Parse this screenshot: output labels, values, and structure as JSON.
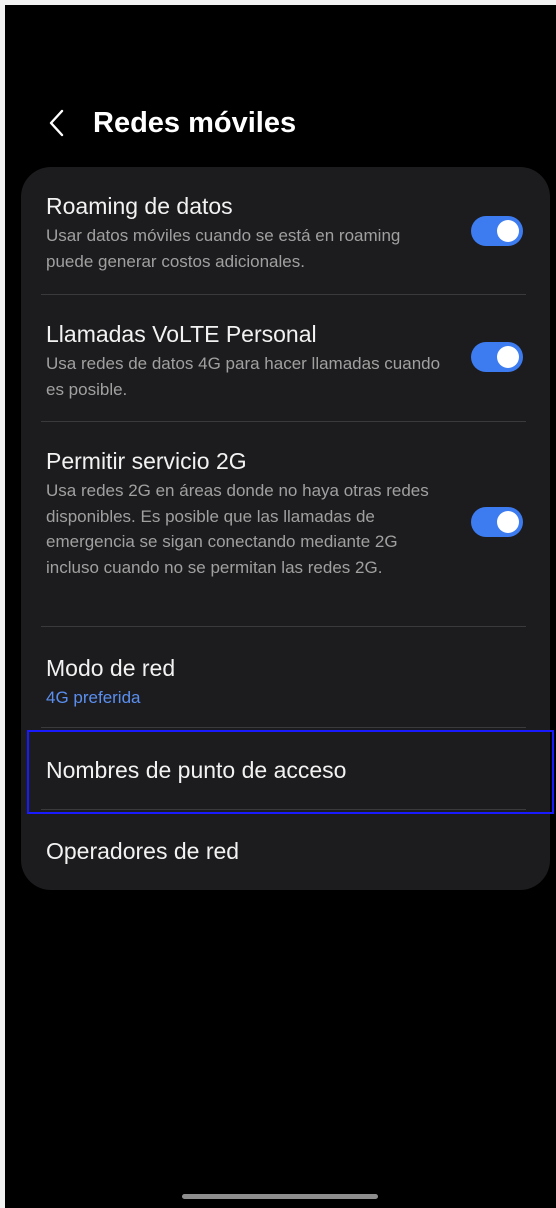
{
  "header": {
    "title": "Redes móviles",
    "back_icon": "chevron-left-icon"
  },
  "settings": {
    "roaming": {
      "title": "Roaming de datos",
      "description": "Usar datos móviles cuando se está en roaming puede generar costos adicionales.",
      "enabled": true
    },
    "volte": {
      "title": "Llamadas VoLTE Personal",
      "description": "Usa redes de datos 4G para hacer llamadas cuando es posible.",
      "enabled": true
    },
    "allow_2g": {
      "title": "Permitir servicio 2G",
      "description": "Usa redes 2G en áreas donde no haya otras redes disponibles. Es posible que las llamadas de emergencia se sigan conectando mediante 2G incluso cuando no se permitan las redes 2G.",
      "enabled": true
    },
    "network_mode": {
      "title": "Modo de red",
      "value": "4G preferida"
    },
    "apn": {
      "title": "Nombres de punto de acceso"
    },
    "operators": {
      "title": "Operadores de red"
    }
  },
  "colors": {
    "background": "#000000",
    "card": "#1c1c1e",
    "accent": "#3d7bf0",
    "value_text": "#5a8ff0",
    "highlight": "#1a1aff"
  }
}
